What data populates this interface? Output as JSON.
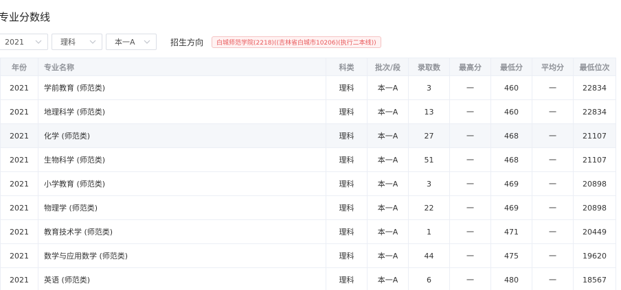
{
  "page": {
    "title": "专业分数线"
  },
  "filters": {
    "year": "2021",
    "subject_type": "理科",
    "batch": "本一A",
    "direction_label": "招生方向",
    "direction_tag": "白城师范学院(2218)((吉林省白城市10206)(执行二本线))"
  },
  "table": {
    "headers": [
      "年份",
      "专业名称",
      "科类",
      "批次/段",
      "录取数",
      "最高分",
      "最低分",
      "平均分",
      "最低位次"
    ],
    "rows": [
      [
        "2021",
        "学前教育 (师范类)",
        "理科",
        "本一A",
        "3",
        "一",
        "460",
        "一",
        "22834"
      ],
      [
        "2021",
        "地理科学 (师范类)",
        "理科",
        "本一A",
        "13",
        "一",
        "460",
        "一",
        "22834"
      ],
      [
        "2021",
        "化学 (师范类)",
        "理科",
        "本一A",
        "27",
        "一",
        "468",
        "一",
        "21107"
      ],
      [
        "2021",
        "生物科学 (师范类)",
        "理科",
        "本一A",
        "51",
        "一",
        "468",
        "一",
        "21107"
      ],
      [
        "2021",
        "小学教育 (师范类)",
        "理科",
        "本一A",
        "3",
        "一",
        "469",
        "一",
        "20898"
      ],
      [
        "2021",
        "物理学 (师范类)",
        "理科",
        "本一A",
        "22",
        "一",
        "469",
        "一",
        "20898"
      ],
      [
        "2021",
        "教育技术学 (师范类)",
        "理科",
        "本一A",
        "1",
        "一",
        "471",
        "一",
        "20449"
      ],
      [
        "2021",
        "数学与应用数学 (师范类)",
        "理科",
        "本一A",
        "44",
        "一",
        "475",
        "一",
        "19620"
      ],
      [
        "2021",
        "英语 (师范类)",
        "理科",
        "本一A",
        "6",
        "一",
        "480",
        "一",
        "18567"
      ]
    ],
    "highlighted_row": 2
  },
  "icons": {
    "select_chevron": "chevron-down-icon"
  }
}
